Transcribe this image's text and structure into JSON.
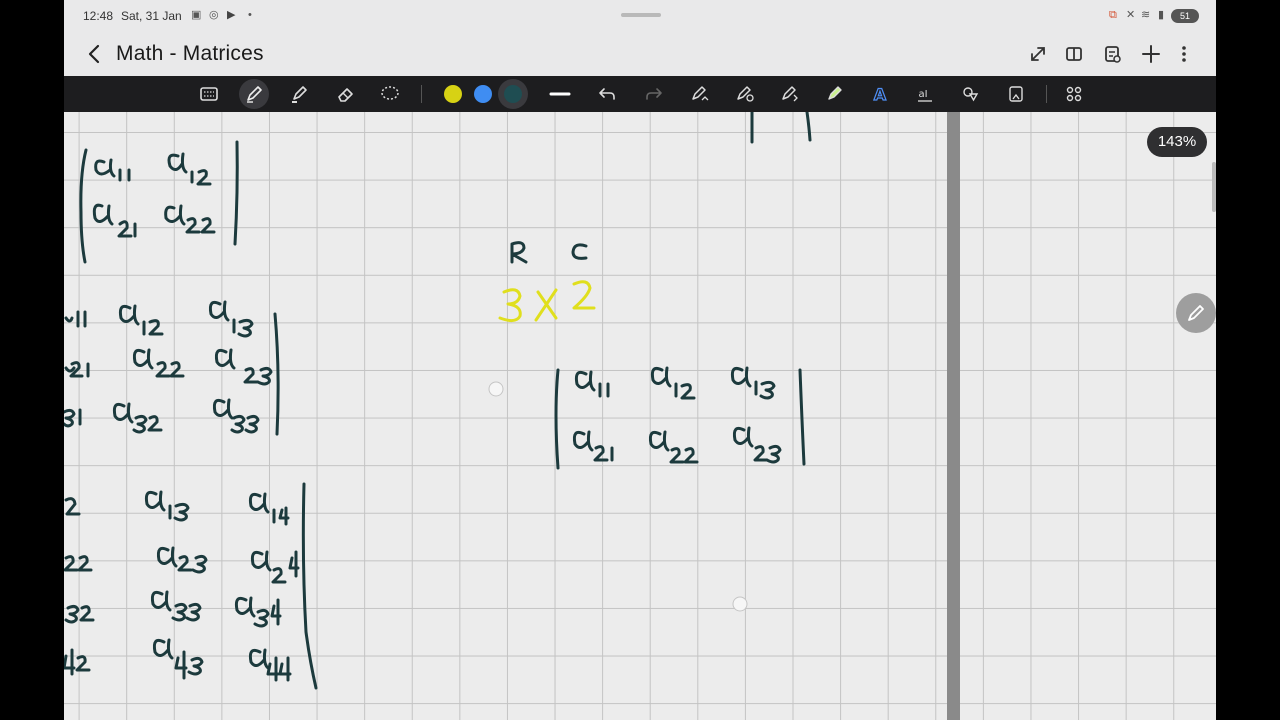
{
  "status_bar": {
    "time": "12:48",
    "date": "Sat, 31 Jan",
    "battery": "51"
  },
  "title_bar": {
    "back_icon": "chevron-left-icon",
    "title": "Math - Matrices",
    "icons": [
      "expand-icon",
      "book-view-icon",
      "notes-list-icon",
      "add-icon",
      "more-icon"
    ]
  },
  "toolbar": {
    "tools": [
      "keyboard-icon",
      "pen-icon",
      "highlighter-icon",
      "eraser-icon",
      "lasso-icon"
    ],
    "colors": [
      "#d7d214",
      "#3f8df2",
      "#1f4d52"
    ],
    "actions": [
      "stroke-width-icon",
      "undo-icon",
      "redo-icon",
      "pen-settings-icon",
      "shape-pen-icon",
      "pen-convert-icon",
      "marker-icon",
      "text-style-icon",
      "text-box-icon",
      "shapes-icon",
      "insert-icon",
      "grid-menu-icon"
    ]
  },
  "canvas": {
    "zoom": "143%",
    "accent_ink": "#1c3a3d",
    "highlight_ink": "#e0df1d"
  }
}
